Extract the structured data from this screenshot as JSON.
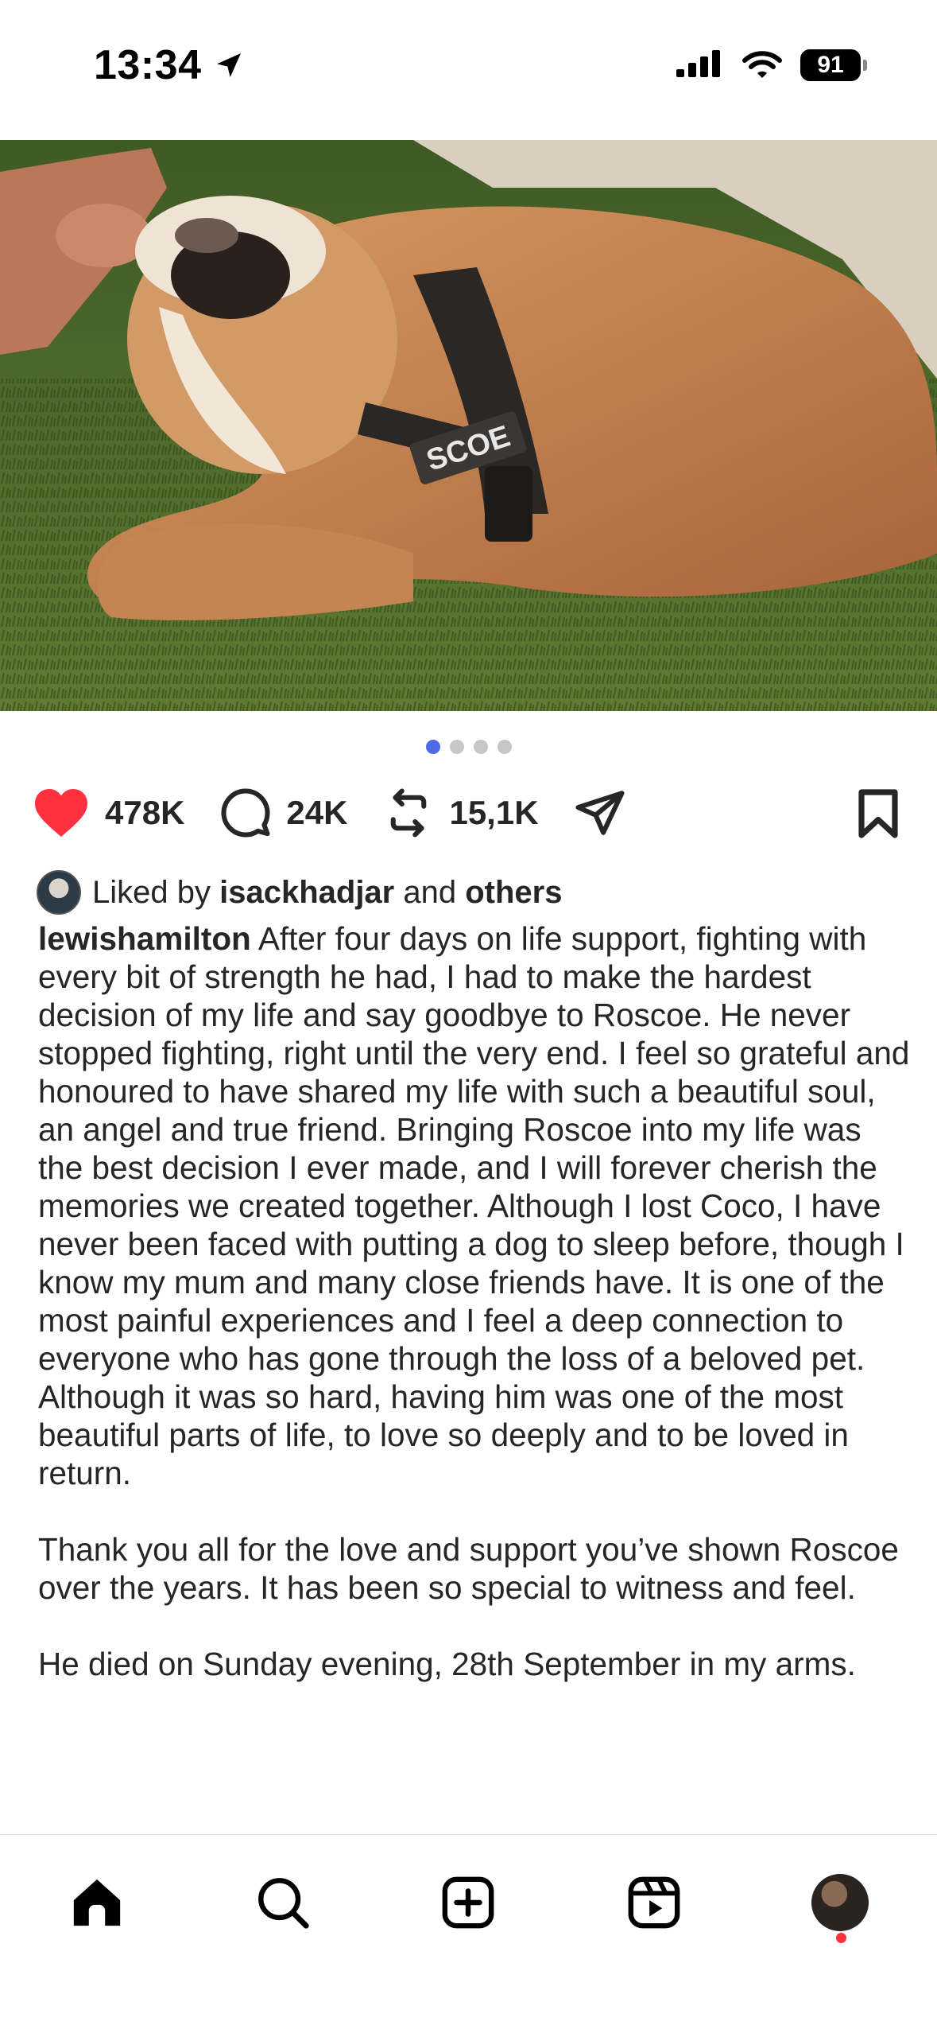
{
  "status_bar": {
    "time": "13:34",
    "battery": "91"
  },
  "post": {
    "image_description": "bulldog-wearing-harness-lying-on-grass",
    "harness_text": "SCOE",
    "carousel": {
      "count": 4,
      "active_index": 0
    },
    "actions": {
      "likes": "478K",
      "comments": "24K",
      "reposts": "15,1K"
    },
    "liked_by": {
      "prefix": "Liked by ",
      "user": "isackhadjar",
      "middle": " and ",
      "others": "others"
    },
    "caption": {
      "username": "lewishamilton",
      "paragraph1": " After four days on life support, fighting with every bit of strength he had, I had to make the hardest decision of my life and say goodbye to Roscoe. He never stopped fighting, right until the very end. I feel so grateful and honoured to have shared my life with such a beautiful soul, an angel and true friend. Bringing Roscoe into my life was the best decision I ever made, and I will forever cherish the memories we created together. Although I lost Coco, I have never been faced with putting a dog to sleep before, though I know my mum and many close friends have. It is one of the most painful experiences and I feel a deep connection to everyone who has gone through the loss of a beloved pet. Although it was so hard, having him was one of the most beautiful parts of life, to love so deeply and to be loved in return.",
      "paragraph2": "Thank you all for the love and support you’ve shown Roscoe over the years. It has been so special to witness and feel.",
      "paragraph3": "He died on Sunday evening, 28th September in my arms."
    }
  },
  "colors": {
    "heart": "#ff3040",
    "active_dot": "#4f6be8",
    "text": "#262626"
  }
}
